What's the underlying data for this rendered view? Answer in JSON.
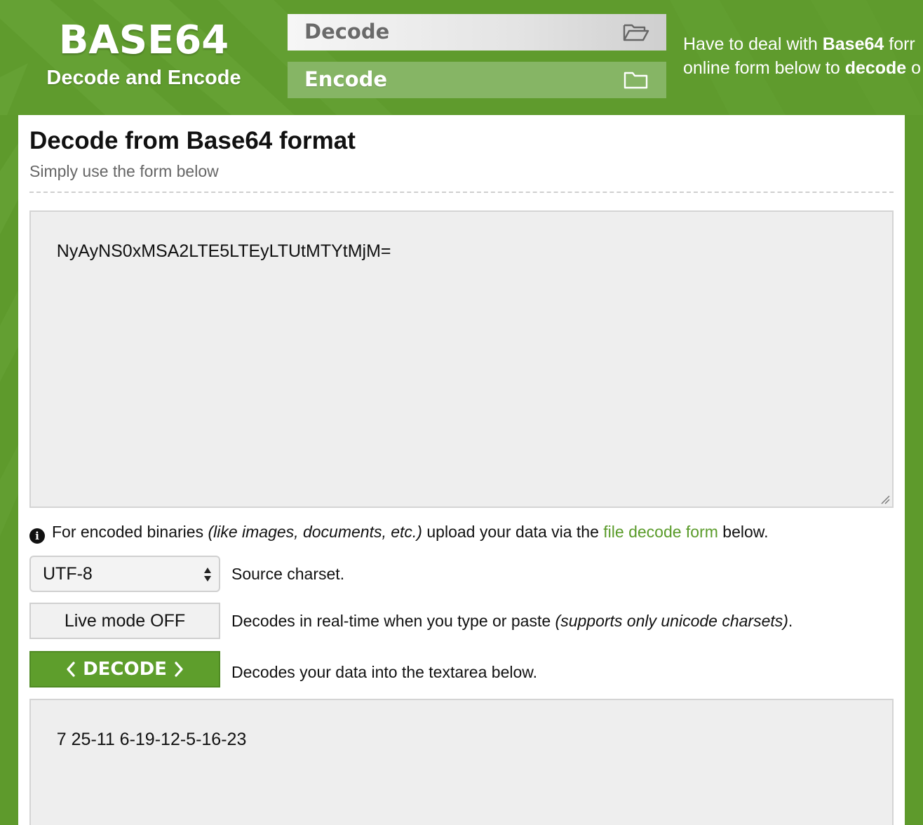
{
  "colors": {
    "brand_green": "#5e9a2c",
    "link_green": "#5a9b2a",
    "panel_bg": "#ffffff",
    "textarea_bg": "#eeeeee"
  },
  "header": {
    "logo_title": "BASE64",
    "logo_subtitle": "Decode and Encode",
    "tabs": [
      {
        "label": "Decode",
        "icon": "folder-open-icon",
        "active": true
      },
      {
        "label": "Encode",
        "icon": "folder-icon",
        "active": false
      }
    ],
    "intro": {
      "line1_prefix": "Have to deal with ",
      "line1_bold": "Base64",
      "line1_suffix": " forr",
      "line2_prefix": "online form below to ",
      "line2_bold": "decode",
      "line2_suffix": " o"
    }
  },
  "main": {
    "title": "Decode from Base64 format",
    "subtitle": "Simply use the form below",
    "input_value": "NyAyNS0xMSA2LTE5LTEyLTUtMTYtMjM=",
    "info": {
      "icon": "info-icon",
      "prefix": "For encoded binaries ",
      "italic": "(like images, documents, etc.)",
      "middle": " upload your data via the ",
      "link": "file decode form",
      "suffix": " below."
    },
    "charset": {
      "value": "UTF-8",
      "description": "Source charset."
    },
    "live_mode": {
      "label": "Live mode OFF",
      "description_prefix": "Decodes in real-time when you type or paste ",
      "description_italic": "(supports only unicode charsets)",
      "description_suffix": "."
    },
    "decode_button": {
      "label": "DECODE",
      "description": "Decodes your data into the textarea below."
    },
    "output_value": "7 25-11 6-19-12-5-16-23"
  }
}
